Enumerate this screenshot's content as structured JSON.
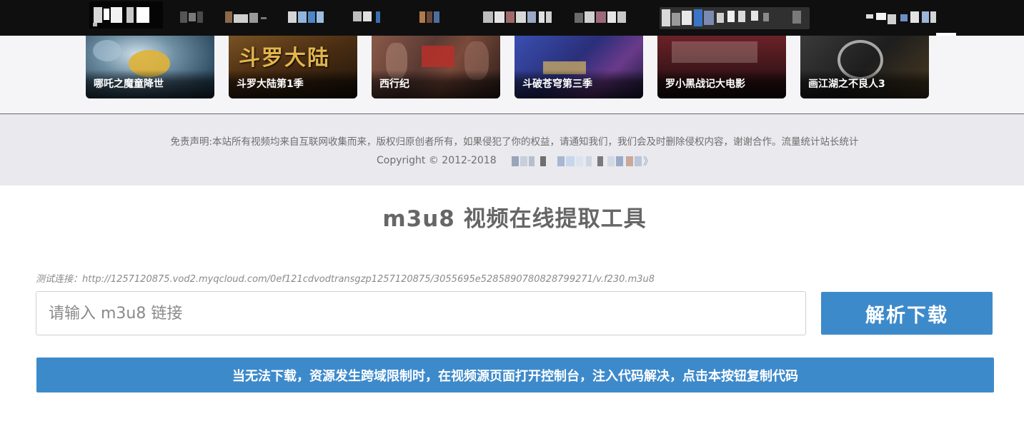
{
  "posters": [
    {
      "caption": "哪吒之魔童降世",
      "art_title": "",
      "color": "#3c5a70"
    },
    {
      "caption": "斗罗大陆第1季",
      "art_title": "斗罗大陆",
      "color": "#5c3616"
    },
    {
      "caption": "西行纪",
      "art_title": "",
      "color": "#6b4036"
    },
    {
      "caption": "斗破苍穹第三季",
      "art_title": "",
      "color": "#2c3d8a"
    },
    {
      "caption": "罗小黑战记大电影",
      "art_title": "",
      "color": "#5a1e24"
    },
    {
      "caption": "画江湖之不良人3",
      "art_title": "",
      "color": "#2a2a2a"
    }
  ],
  "footer": {
    "disclaimer": "免责声明:本站所有视频均来自互联网收集而来，版权归原创者所有，如果侵犯了你的权益，请通知我们，我们会及时删除侵权内容，谢谢合作。流量统计站长统计",
    "copyright": "Copyright © 2012-2018",
    "redacted_tail": "》"
  },
  "tool": {
    "title": "m3u8 视频在线提取工具",
    "sample_link": "测试连接：http://1257120875.vod2.myqcloud.com/0ef121cdvodtransgzp1257120875/3055695e5285890780828799271/v.f230.m3u8",
    "input_placeholder": "请输入 m3u8 链接",
    "parse_button": "解析下载",
    "copy_code_button": "当无法下载，资源发生跨域限制时，在视频源页面打开控制台，注入代码解决，点击本按钮复制代码"
  },
  "colors": {
    "nav_bg": "#0f0f0f",
    "button_blue": "#3d8acb",
    "footer_bg": "#e9e9ee"
  }
}
